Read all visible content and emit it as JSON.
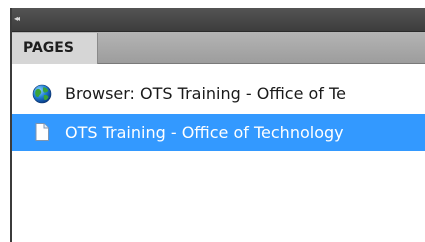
{
  "panel": {
    "collapse_icon": "double-chevron-left-icon",
    "collapse_glyph": "◂◂",
    "tab_label": "PAGES"
  },
  "pages": [
    {
      "label": "Browser: OTS Training - Office of Te",
      "icon": "globe-icon",
      "selected": false
    },
    {
      "label": "OTS Training  - Office of Technology",
      "icon": "page-icon",
      "selected": true
    }
  ],
  "colors": {
    "selection": "#3399ff",
    "titlebar": "#484848",
    "tabbar": "#a8a8a8",
    "active_tab": "#d6d6d6"
  }
}
